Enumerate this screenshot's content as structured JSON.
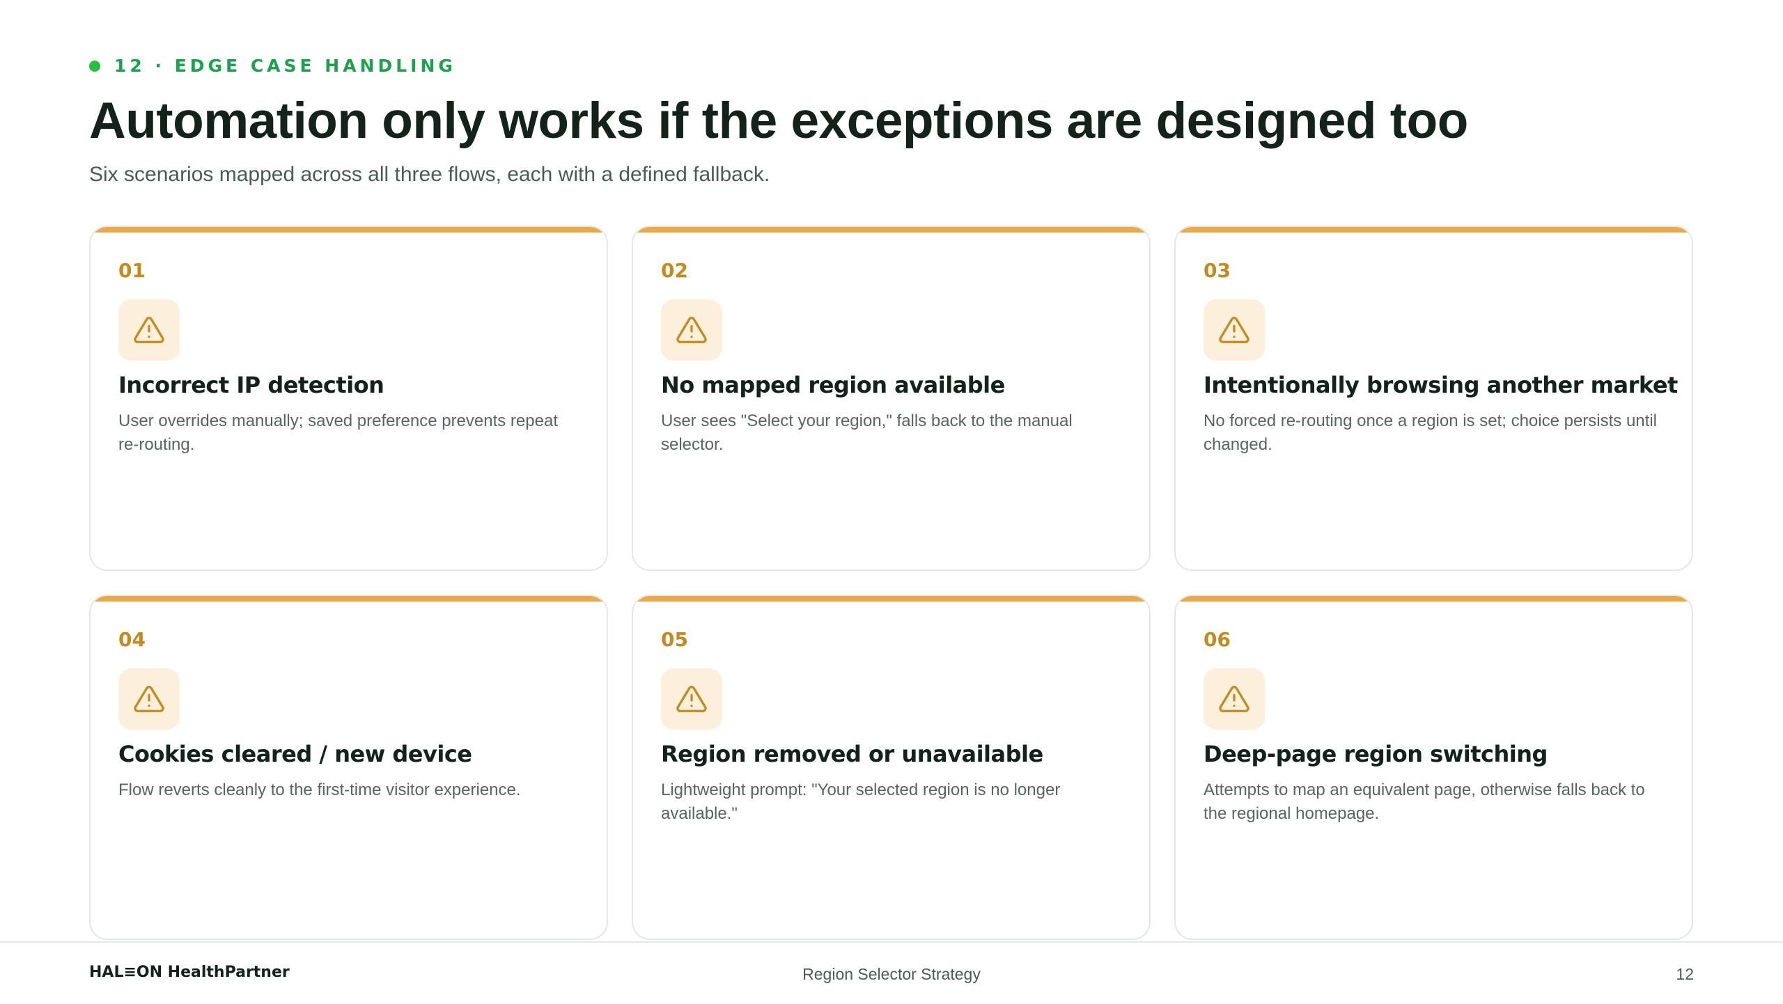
{
  "header": {
    "eyebrow": "12 · EDGE CASE HANDLING",
    "title": "Automation only works if the exceptions are designed too",
    "subtitle": "Six scenarios mapped across all three flows, each with a defined fallback."
  },
  "colors": {
    "accent": "#e9a94a",
    "number": "#c58a1c",
    "icon_bg": "#fcefdc",
    "eyebrow": "#1aa34a",
    "title": "#13231c"
  },
  "cards": [
    {
      "number": "01",
      "icon": "warning-triangle-icon",
      "title": "Incorrect IP detection",
      "description": "User overrides manually; saved preference prevents repeat re-routing."
    },
    {
      "number": "02",
      "icon": "warning-triangle-icon",
      "title": "No mapped region available",
      "description": "User sees \"Select your region,\" falls back to the manual selector."
    },
    {
      "number": "03",
      "icon": "warning-triangle-icon",
      "title": "Intentionally browsing another market",
      "description": "No forced re-routing once a region is set; choice persists until changed."
    },
    {
      "number": "04",
      "icon": "warning-triangle-icon",
      "title": "Cookies cleared / new device",
      "description": "Flow reverts cleanly to the first-time visitor experience."
    },
    {
      "number": "05",
      "icon": "warning-triangle-icon",
      "title": "Region removed or unavailable",
      "description": "Lightweight prompt: \"Your selected region is no longer available.\""
    },
    {
      "number": "06",
      "icon": "warning-triangle-icon",
      "title": "Deep-page region switching",
      "description": "Attempts to map an equivalent page, otherwise falls back to the regional homepage."
    }
  ],
  "footer": {
    "brand": "HAL≡ON HealthPartner",
    "center": "Region Selector Strategy",
    "page_number": "12"
  }
}
